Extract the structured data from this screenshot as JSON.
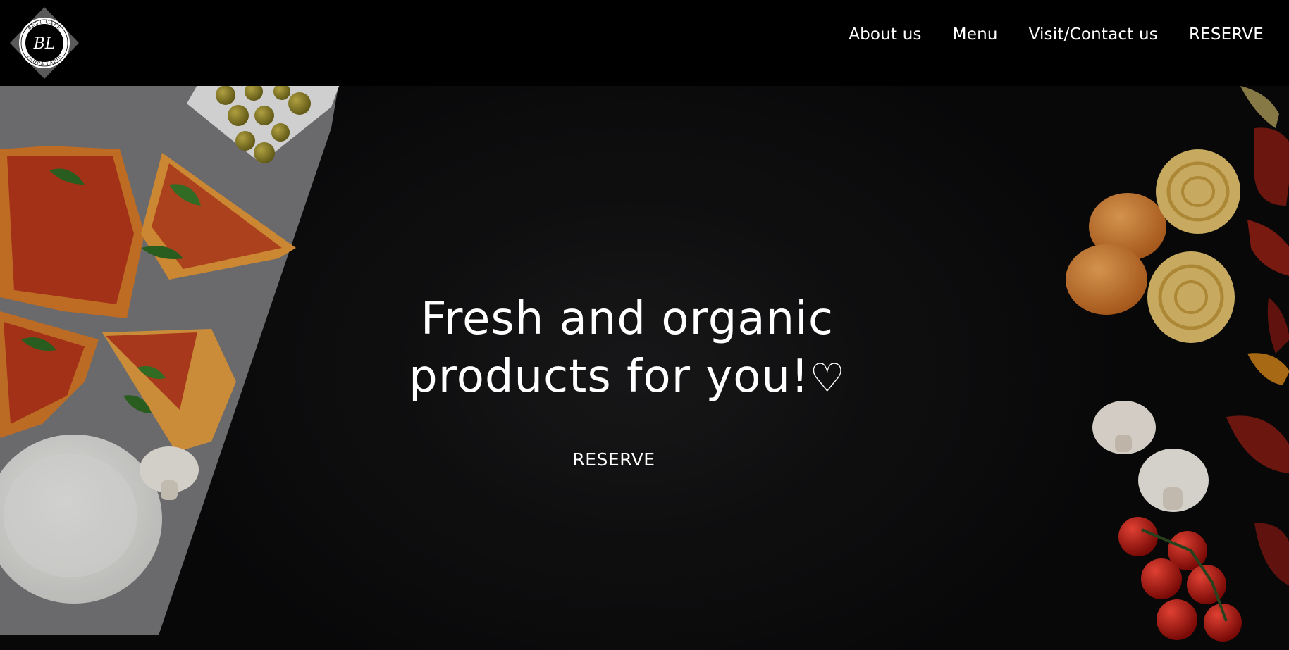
{
  "brand": {
    "logo_text_top": "BEST CAFE",
    "logo_monogram": "BL",
    "logo_text_bottom": "ZAHRA LABIB"
  },
  "nav": {
    "items": [
      {
        "label": "About us"
      },
      {
        "label": "Menu"
      },
      {
        "label": "Visit/Contact us"
      },
      {
        "label": "RESERVE"
      }
    ]
  },
  "hero": {
    "headline_line1": "Fresh and organic",
    "headline_line2": "products for you!",
    "headline_heart": "♡",
    "cta_label": "RESERVE"
  },
  "colors": {
    "header_bg": "#000000",
    "hero_bg": "#111112",
    "text": "#ffffff"
  }
}
